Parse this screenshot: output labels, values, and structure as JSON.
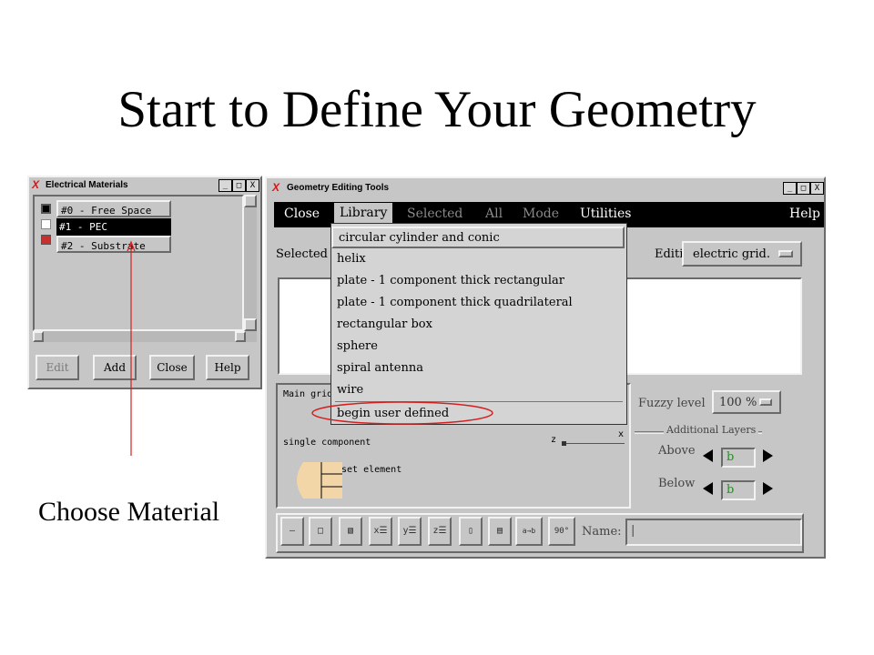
{
  "slide": {
    "title": "Start to Define Your Geometry",
    "caption": "Choose Material"
  },
  "electrical_materials": {
    "title": "Electrical Materials",
    "window_buttons": [
      "_",
      "□",
      "X"
    ],
    "materials": [
      {
        "label": "#0 - Free Space",
        "selected": false
      },
      {
        "label": "#1 - PEC",
        "selected": true
      },
      {
        "label": "#2 - Substrate",
        "selected": false
      }
    ],
    "buttons": {
      "edit": "Edit",
      "add": "Add",
      "close": "Close",
      "help": "Help"
    }
  },
  "geometry_tools": {
    "title": "Geometry Editing Tools",
    "window_buttons": [
      "_",
      "□",
      "X"
    ],
    "menu": {
      "close": "Close",
      "library": "Library",
      "selected": "Selected",
      "all": "All",
      "mode": "Mode",
      "utilities": "Utilities",
      "help": "Help"
    },
    "selected_label": "Selected N",
    "editing_label": "Editing",
    "editing_value": "electric grid.",
    "main_grid_label": "Main grid",
    "single_component_label": "single component",
    "set_element_label": "set element",
    "axis_z": "z",
    "axis_x": "x",
    "fuzzy_level_label": "Fuzzy level",
    "fuzzy_level_value": "100 %",
    "additional_layers_label": "Additional Layers",
    "above_label": "Above",
    "below_label": "Below",
    "above_value": "b",
    "below_value": "b",
    "name_label": "Name:",
    "name_value": "|",
    "tool_glyphs": [
      "—",
      "□",
      "▧",
      "x☰",
      "y☰",
      "z☰",
      "▯",
      "▤",
      "a→b",
      "90°"
    ]
  },
  "library_menu": {
    "items": [
      "circular cylinder and conic",
      "helix",
      "plate - 1 component thick rectangular",
      "plate - 1 component thick quadrilateral",
      "rectangular box",
      "sphere",
      "spiral antenna",
      "wire",
      "begin user defined"
    ]
  },
  "colors": {
    "window_bg": "#c6c6c6",
    "menubar_bg": "#000000",
    "highlight_ellipse": "#d42020",
    "annotation_line": "#d42020",
    "selected_row_bg": "#000000",
    "swatch_pec": "#c83030",
    "component_shape": "#f2d6a8"
  }
}
